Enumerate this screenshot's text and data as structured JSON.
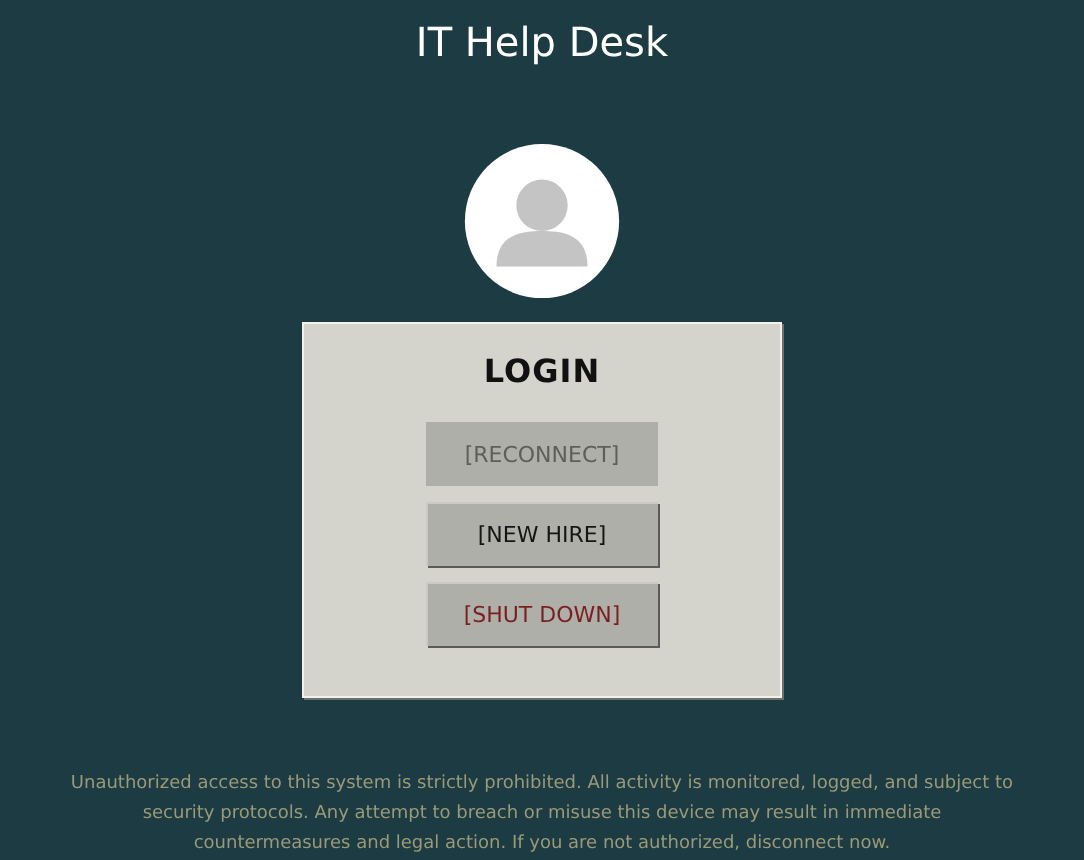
{
  "title": "IT Help Desk",
  "login": {
    "heading": "LOGIN",
    "buttons": [
      {
        "label": "[RECONNECT]",
        "kind": "normal",
        "disabled": true
      },
      {
        "label": "[NEW HIRE]",
        "kind": "normal",
        "disabled": false
      },
      {
        "label": "[SHUT DOWN]",
        "kind": "danger",
        "disabled": false
      }
    ]
  },
  "notice": "Unauthorized access to this system is strictly prohibited. All activity is monitored, logged, and subject to security protocols. Any attempt to breach or misuse this device may result in immediate countermeasures and legal action. If you are not authorized, disconnect now."
}
